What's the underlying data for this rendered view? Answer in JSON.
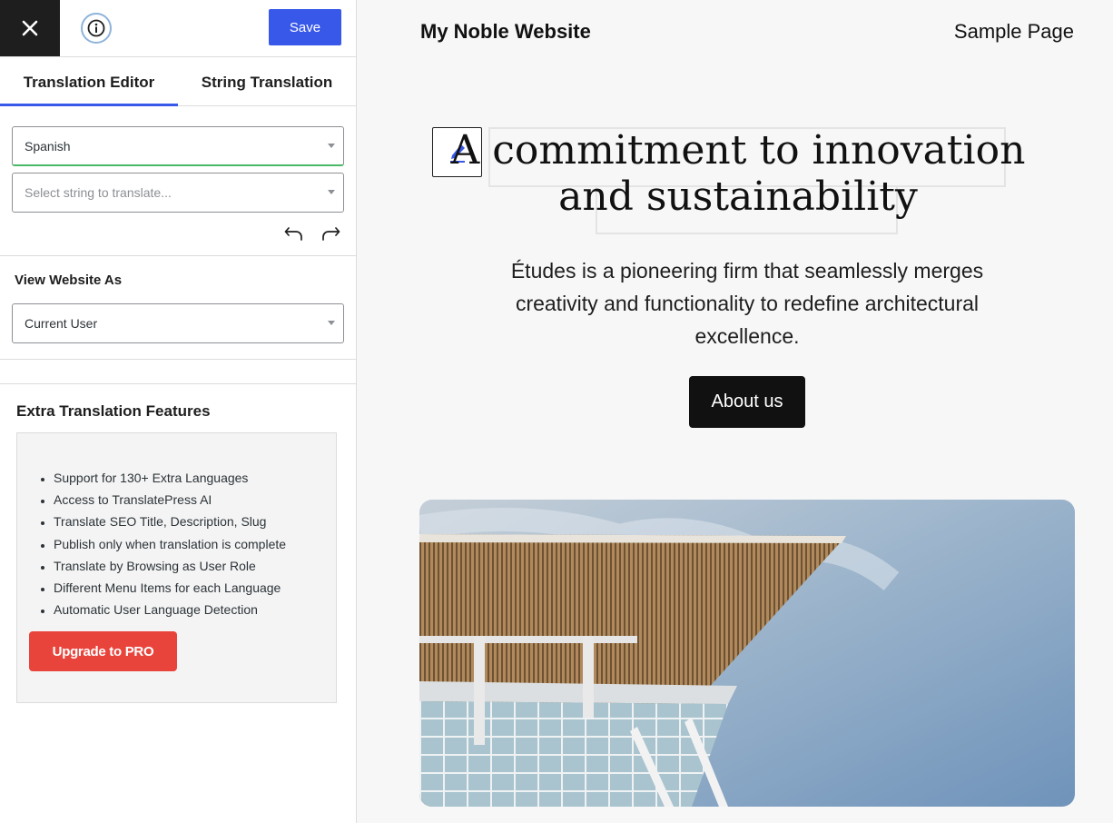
{
  "sidebar": {
    "save_label": "Save",
    "tabs": [
      {
        "label": "Translation Editor",
        "active": true
      },
      {
        "label": "String Translation",
        "active": false
      }
    ],
    "language_select": {
      "value": "Spanish"
    },
    "string_select": {
      "placeholder": "Select string to translate..."
    },
    "view_as": {
      "title": "View Website As",
      "value": "Current User"
    },
    "extra_features": {
      "title": "Extra Translation Features",
      "items": [
        "Support for 130+ Extra Languages",
        "Access to TranslatePress AI",
        "Translate SEO Title, Description, Slug",
        "Publish only when translation is complete",
        "Translate by Browsing as User Role",
        "Different Menu Items for each Language",
        "Automatic User Language Detection"
      ],
      "upgrade_label": "Upgrade to PRO"
    }
  },
  "preview": {
    "site_title": "My Noble Website",
    "nav_link": "Sample Page",
    "heading_line1": "A commitment to innovation",
    "heading_line2": "and sustainability",
    "lead": "Études is a pioneering firm that seamlessly merges creativity and functionality to redefine architectural excellence.",
    "button_label": "About us"
  },
  "colors": {
    "accent": "#3858e9",
    "upgrade": "#e9443b",
    "dark": "#1e1e1e",
    "focus_green": "#4ab866"
  },
  "icons": [
    "close-icon",
    "info-icon",
    "caret-down-icon",
    "undo-icon",
    "redo-icon",
    "pencil-icon"
  ]
}
